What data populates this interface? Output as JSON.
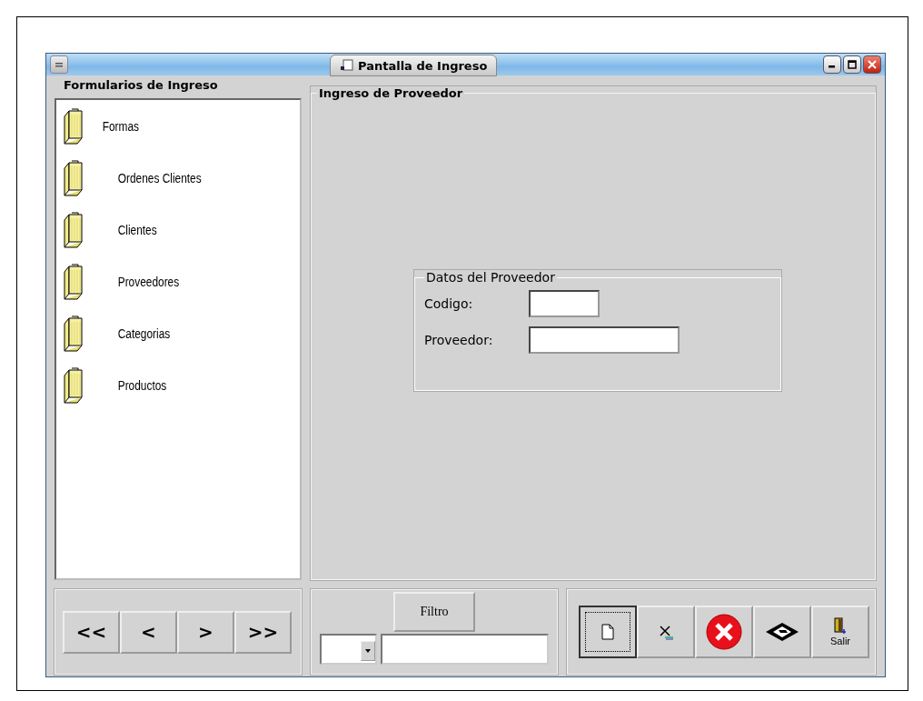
{
  "window": {
    "title": "Pantalla de Ingreso"
  },
  "sidebar": {
    "title": "Formularios de Ingreso",
    "tree": [
      {
        "label": "Formas",
        "children": [
          {
            "label": "Ordenes Clientes"
          },
          {
            "label": "Clientes"
          },
          {
            "label": "Proveedores"
          },
          {
            "label": "Categorias"
          },
          {
            "label": "Productos"
          }
        ]
      }
    ]
  },
  "main": {
    "title": "Ingreso de Proveedor",
    "group": {
      "title": "Datos del Proveedor",
      "fields": [
        {
          "label": "Codigo:",
          "kind": "short"
        },
        {
          "label": "Proveedor:",
          "kind": "long"
        }
      ]
    }
  },
  "nav_buttons": [
    "<<",
    "<",
    ">",
    ">>"
  ],
  "filter": {
    "button": "Filtro"
  },
  "toolbar": [
    {
      "kind": "new",
      "focused": true
    },
    {
      "kind": "delete",
      "focused": false
    },
    {
      "kind": "cancel",
      "focused": false
    },
    {
      "kind": "save",
      "focused": false
    },
    {
      "kind": "exit",
      "label": "Salir",
      "focused": false
    }
  ]
}
